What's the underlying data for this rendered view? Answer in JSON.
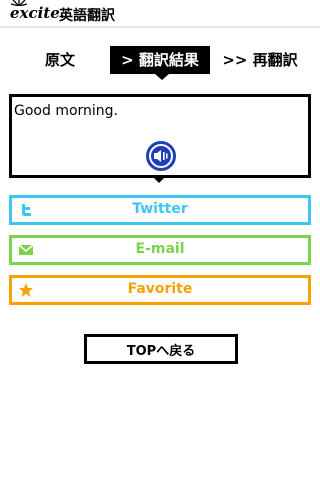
{
  "header": {
    "logo_text": "excite.",
    "title": "英語翻訳"
  },
  "tabs": [
    {
      "label": "原文"
    },
    {
      "label": "> 翻訳結果"
    },
    {
      "label": ">> 再翻訳"
    }
  ],
  "result": {
    "text": "Good morning.",
    "speaker_icon": "speaker-icon"
  },
  "actions": {
    "twitter": {
      "label": "Twitter",
      "icon": "twitter-icon",
      "color": "#3ec6f2"
    },
    "email": {
      "label": "E-mail",
      "icon": "mail-icon",
      "color": "#7bd24b"
    },
    "favorite": {
      "label": "Favorite",
      "icon": "star-icon",
      "color": "#f5a300"
    }
  },
  "top_button": {
    "label": "TOPへ戻る"
  }
}
